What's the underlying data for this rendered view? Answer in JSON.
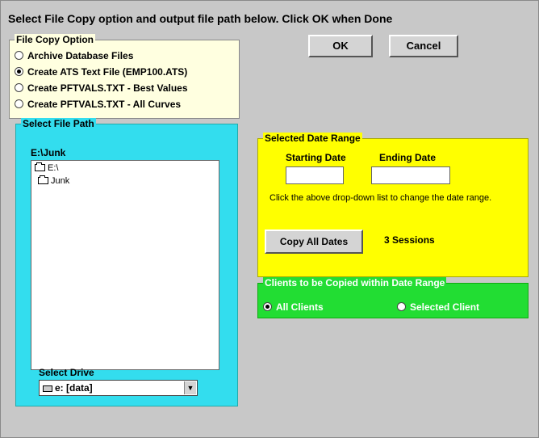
{
  "instructions": "Select File Copy option and output file path below.  Click OK when Done",
  "buttons": {
    "ok": "OK",
    "cancel": "Cancel"
  },
  "file_copy": {
    "legend": "File Copy Option",
    "options": [
      {
        "label": "Archive Database Files",
        "selected": false
      },
      {
        "label": "Create ATS Text File (EMP100.ATS)",
        "selected": true
      },
      {
        "label": "Create PFTVALS.TXT - Best Values",
        "selected": false
      },
      {
        "label": "Create PFTVALS.TXT - All Curves",
        "selected": false
      }
    ]
  },
  "file_path": {
    "legend": "Select File Path",
    "current_path": "E:\\Junk",
    "tree": [
      "E:\\",
      "Junk"
    ],
    "drive_label": "Select Drive",
    "drive_value": "e: [data]"
  },
  "date_range": {
    "legend": "Selected Date Range",
    "start_label": "Starting Date",
    "end_label": "Ending Date",
    "start_value": "",
    "end_value": "",
    "hint": "Click the above drop-down list to change the date range.",
    "copy_all": "Copy All Dates",
    "sessions": "3 Sessions"
  },
  "clients": {
    "legend": "Clients to be Copied within Date Range",
    "all": "All Clients",
    "selected": "Selected Client",
    "all_selected": true
  },
  "colors": {
    "file_copy_bg": "#ffffe0",
    "file_path_bg": "#33ddee",
    "date_range_bg": "#ffff00",
    "clients_bg": "#22dd33",
    "window_bg": "#c8c8c8"
  }
}
